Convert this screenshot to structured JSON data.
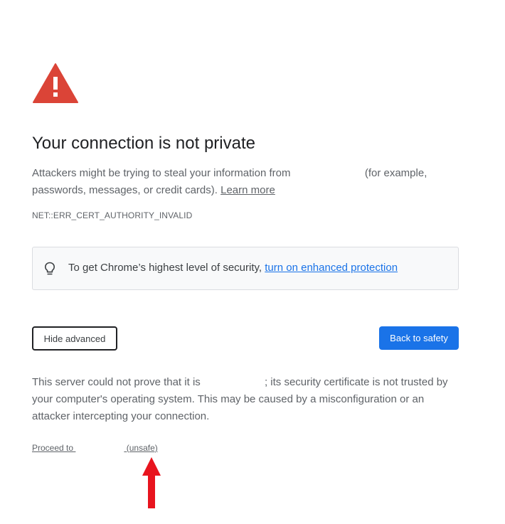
{
  "page": {
    "title": "Your connection is not private",
    "explanation_before": "Attackers might be trying to steal your information from",
    "explanation_after": "(for example, passwords, messages, or credit cards).",
    "learn_more": "Learn more",
    "error_code": "NET::ERR_CERT_AUTHORITY_INVALID"
  },
  "tip": {
    "text": "To get Chrome’s highest level of security,",
    "link": "turn on enhanced protection",
    "icon": "lightbulb-icon"
  },
  "buttons": {
    "hide_advanced": "Hide advanced",
    "back_to_safety": "Back to safety"
  },
  "details": {
    "text_before": "This server could not prove that it is",
    "text_after": "; its security certificate is not trusted by your computer's operating system. This may be caused by a misconfiguration or an attacker intercepting your connection."
  },
  "proceed": {
    "prefix": "Proceed to",
    "suffix": "(unsafe)"
  },
  "colors": {
    "warning_red": "#db4437",
    "primary_blue": "#1a73e8",
    "arrow_red": "#e8141e"
  }
}
